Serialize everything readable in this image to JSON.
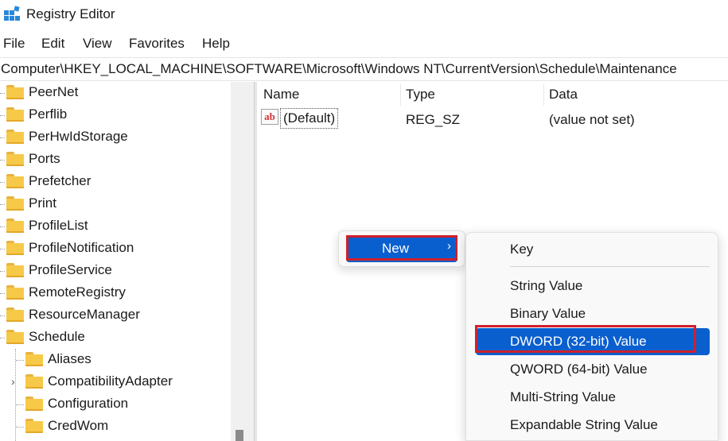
{
  "window": {
    "title": "Registry Editor",
    "app_icon": "registry-editor-icon"
  },
  "menubar": {
    "items": [
      "File",
      "Edit",
      "View",
      "Favorites",
      "Help"
    ]
  },
  "address": {
    "path": "Computer\\HKEY_LOCAL_MACHINE\\SOFTWARE\\Microsoft\\Windows NT\\CurrentVersion\\Schedule\\Maintenance"
  },
  "tree": {
    "items": [
      {
        "label": "PeerNet",
        "depth": 0
      },
      {
        "label": "Perflib",
        "depth": 0
      },
      {
        "label": "PerHwIdStorage",
        "depth": 0
      },
      {
        "label": "Ports",
        "depth": 0
      },
      {
        "label": "Prefetcher",
        "depth": 0
      },
      {
        "label": "Print",
        "depth": 0
      },
      {
        "label": "ProfileList",
        "depth": 0
      },
      {
        "label": "ProfileNotification",
        "depth": 0
      },
      {
        "label": "ProfileService",
        "depth": 0
      },
      {
        "label": "RemoteRegistry",
        "depth": 0
      },
      {
        "label": "ResourceManager",
        "depth": 0
      },
      {
        "label": "Schedule",
        "depth": 0,
        "expanded": true
      },
      {
        "label": "Aliases",
        "depth": 1
      },
      {
        "label": "CompatibilityAdapter",
        "depth": 1,
        "has_children": true
      },
      {
        "label": "Configuration",
        "depth": 1
      },
      {
        "label": "CredWom",
        "depth": 1
      }
    ],
    "expander_glyph": "›"
  },
  "values": {
    "columns": {
      "name": "Name",
      "type": "Type",
      "data": "Data"
    },
    "rows": [
      {
        "icon": "string-value-icon",
        "icon_text": "ab",
        "name": "(Default)",
        "type": "REG_SZ",
        "data": "(value not set)"
      }
    ]
  },
  "context_menu": {
    "new_label": "New",
    "new_arrow": "›"
  },
  "submenu": {
    "items": [
      {
        "label": "Key",
        "selected": false
      },
      {
        "label": "String Value",
        "selected": false
      },
      {
        "label": "Binary Value",
        "selected": false
      },
      {
        "label": "DWORD (32-bit) Value",
        "selected": true
      },
      {
        "label": "QWORD (64-bit) Value",
        "selected": false
      },
      {
        "label": "Multi-String Value",
        "selected": false
      },
      {
        "label": "Expandable String Value",
        "selected": false
      }
    ]
  },
  "colors": {
    "accent": "#0a5fcf",
    "highlight_outline": "#d0202a",
    "folder": "#f7c948"
  }
}
